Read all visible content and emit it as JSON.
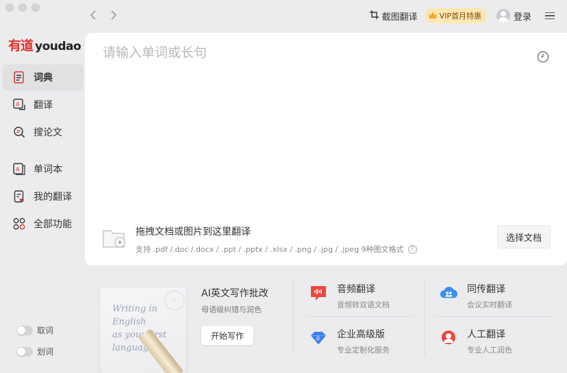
{
  "topbar": {
    "back_icon": "chevron-left-icon",
    "forward_icon": "chevron-right-icon",
    "screenshot_translate_label": "截图翻译",
    "vip_label": "VIP首月特惠",
    "login_label": "登录"
  },
  "logo": {
    "cn": "有道",
    "en": "youdao"
  },
  "sidebar": {
    "items": [
      {
        "label": "词典",
        "icon": "dictionary-icon",
        "active": true
      },
      {
        "label": "翻译",
        "icon": "translate-icon",
        "active": false
      },
      {
        "label": "搜论文",
        "icon": "search-paper-icon",
        "active": false
      },
      {
        "label": "单词本",
        "icon": "wordbook-icon",
        "active": false
      },
      {
        "label": "我的翻译",
        "icon": "my-translation-icon",
        "active": false
      },
      {
        "label": "全部功能",
        "icon": "all-features-icon",
        "active": false
      }
    ],
    "toggles": [
      {
        "label": "取词",
        "on": false
      },
      {
        "label": "划词",
        "on": false
      }
    ]
  },
  "main": {
    "input_placeholder": "请输入单词或长句",
    "input_value": "",
    "drop_title": "拖拽文档或图片到这里翻译",
    "drop_subtitle": "支持 .pdf /.doc /.docx / .ppt / .pptx / .xlsx / .png / .jpg / .jpeg 9种图文格式",
    "choose_file_label": "选择文档"
  },
  "promo": {
    "card_lines": [
      "Writing in",
      "English",
      "as your first",
      "language"
    ],
    "title": "AI英文写作批改",
    "subtitle": "母语级纠错与润色",
    "button_label": "开始写作"
  },
  "features": [
    {
      "title": "音频翻译",
      "subtitle": "音频转双语文档",
      "icon": "audio-translate-icon",
      "color": "#f0463e"
    },
    {
      "title": "同传翻译",
      "subtitle": "会议实时翻译",
      "icon": "simultaneous-translate-icon",
      "color": "#3d8ef0"
    },
    {
      "title": "企业高级版",
      "subtitle": "专业定制化服务",
      "icon": "enterprise-icon",
      "color": "#3d7ef0"
    },
    {
      "title": "人工翻译",
      "subtitle": "专业人工润色",
      "icon": "human-translate-icon",
      "color": "#f0463e"
    }
  ]
}
